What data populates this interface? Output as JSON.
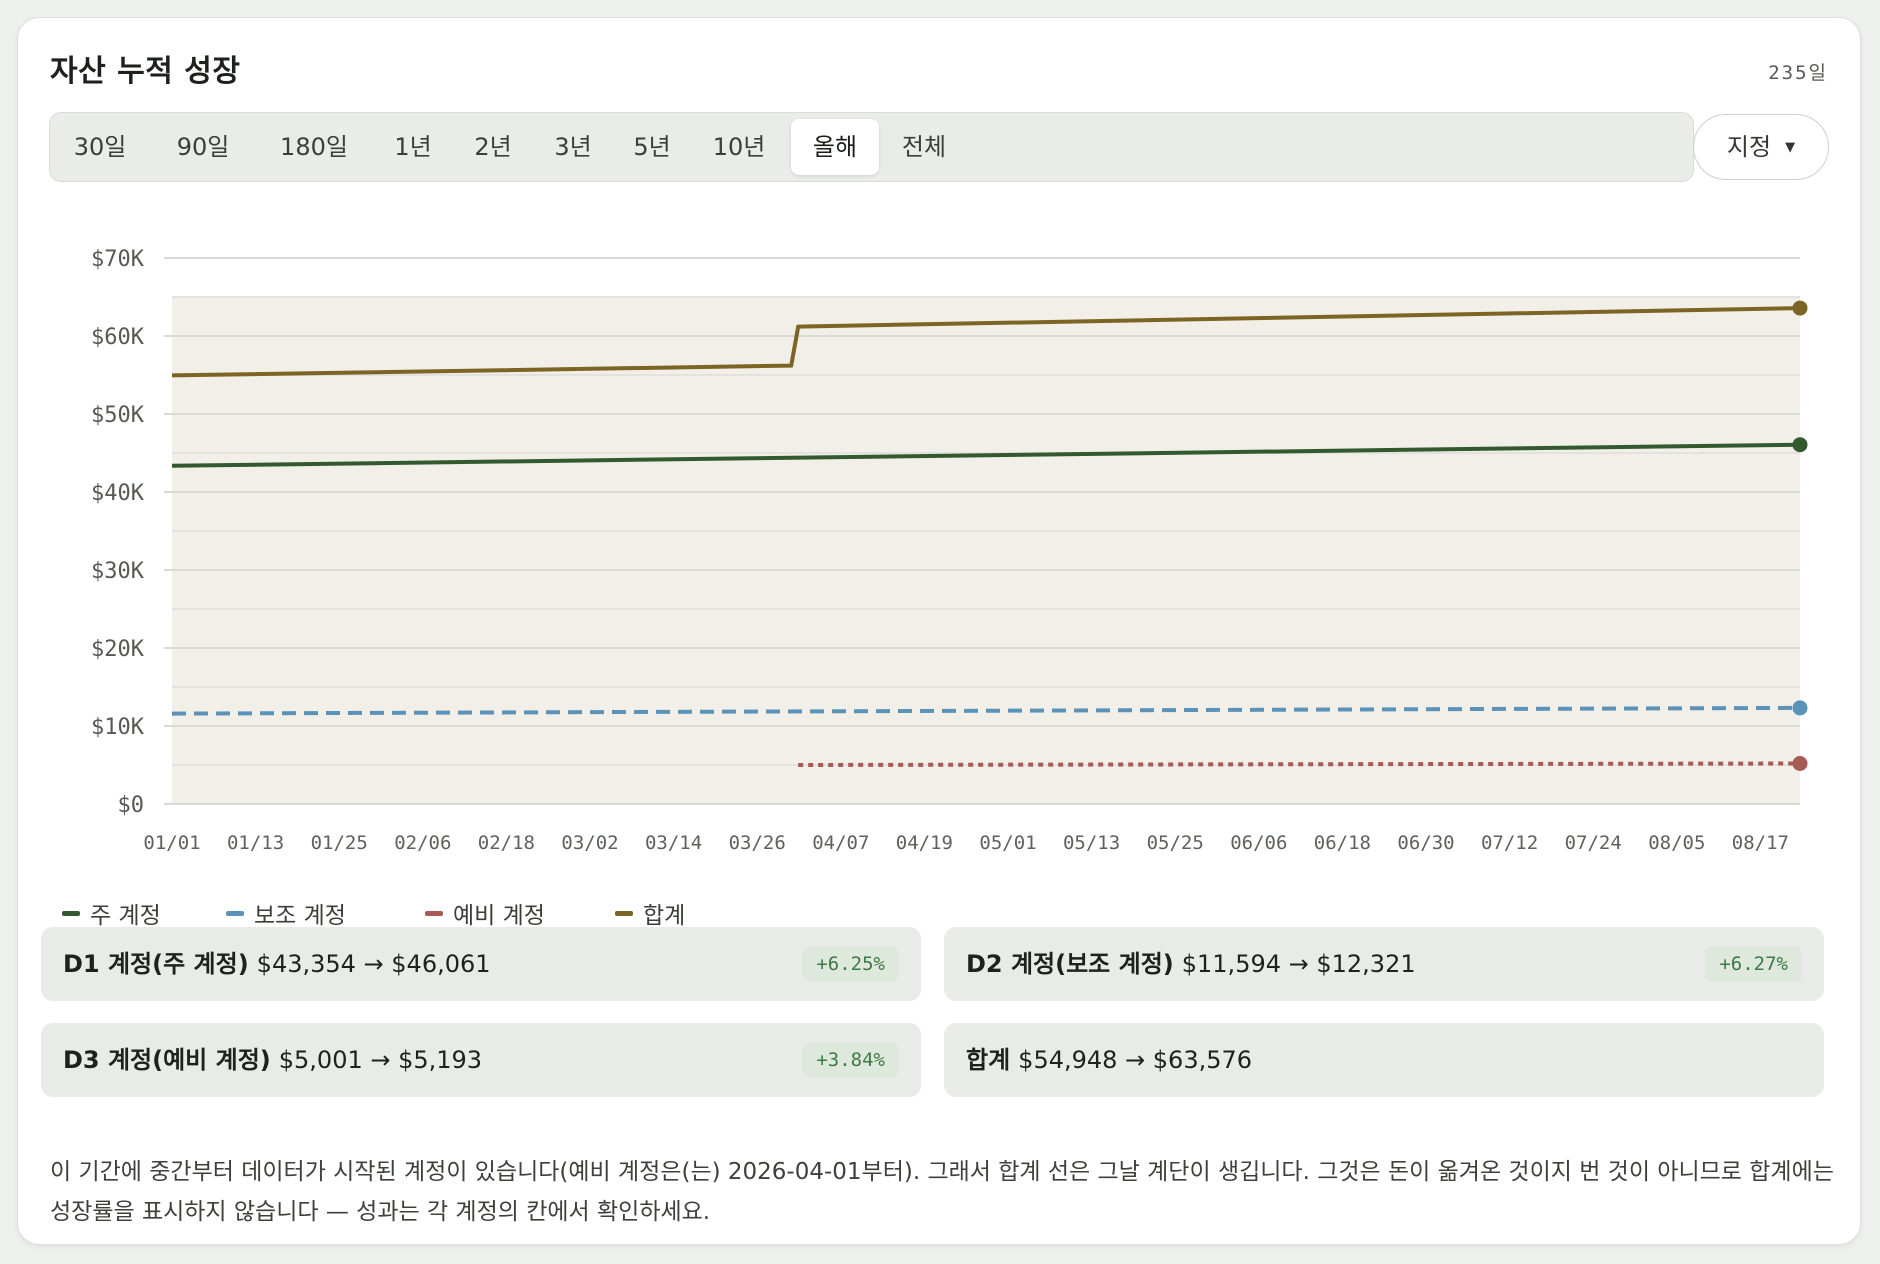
{
  "title": "자산 누적 성장",
  "days_label": "235일",
  "ranges": [
    {
      "label": "30일",
      "active": false
    },
    {
      "label": "90일",
      "active": false
    },
    {
      "label": "180일",
      "active": false
    },
    {
      "label": "1년",
      "active": false
    },
    {
      "label": "2년",
      "active": false
    },
    {
      "label": "3년",
      "active": false
    },
    {
      "label": "5년",
      "active": false
    },
    {
      "label": "10년",
      "active": false
    },
    {
      "label": "올해",
      "active": true
    },
    {
      "label": "전체",
      "active": false
    }
  ],
  "custom_label": "지정",
  "chart_data": {
    "type": "line",
    "ylim": [
      0,
      70000
    ],
    "yticks": [
      "$0",
      "$10K",
      "$20K",
      "$30K",
      "$40K",
      "$50K",
      "$60K",
      "$70K"
    ],
    "yticks_values": [
      0,
      10000,
      20000,
      30000,
      40000,
      50000,
      60000,
      70000
    ],
    "x_ticks": [
      "01/01",
      "01/13",
      "01/25",
      "02/06",
      "02/18",
      "03/02",
      "03/14",
      "03/26",
      "04/07",
      "04/19",
      "05/01",
      "05/13",
      "05/25",
      "06/06",
      "06/18",
      "06/30",
      "07/12",
      "07/24",
      "08/05",
      "08/17"
    ],
    "grid": true,
    "legend_position": "bottom-left",
    "series": [
      {
        "name": "주 계정",
        "color": "#33592f",
        "style": "solid",
        "points": [
          [
            "2026-01-01",
            43354
          ],
          [
            "2026-08-23",
            46061
          ]
        ]
      },
      {
        "name": "보조 계정",
        "color": "#5b93b8",
        "style": "dashed",
        "points": [
          [
            "2026-01-01",
            11594
          ],
          [
            "2026-08-23",
            12321
          ]
        ]
      },
      {
        "name": "예비 계정",
        "color": "#a85a55",
        "style": "dotted",
        "points": [
          [
            "2026-04-01",
            5001
          ],
          [
            "2026-08-23",
            5193
          ]
        ]
      },
      {
        "name": "합계",
        "color": "#7b6424",
        "style": "solid",
        "points": [
          [
            "2026-01-01",
            54948
          ],
          [
            "2026-03-31",
            56202
          ],
          [
            "2026-04-01",
            61210
          ],
          [
            "2026-08-23",
            63576
          ]
        ]
      }
    ]
  },
  "stats": [
    {
      "name": "D1 계정(주 계정)",
      "value": "$43,354 → $46,061",
      "badge": "+6.25%"
    },
    {
      "name": "D2 계정(보조 계정)",
      "value": "$11,594 → $12,321",
      "badge": "+6.27%"
    },
    {
      "name": "D3 계정(예비 계정)",
      "value": "$5,001 → $5,193",
      "badge": "+3.84%"
    },
    {
      "name": "합계",
      "value": "$54,948 → $63,576",
      "badge": ""
    }
  ],
  "note": "이 기간에 중간부터 데이터가 시작된 계정이 있습니다(예비 계정은(는) 2026-04-01부터). 그래서 합계 선은 그날 계단이 생깁니다. 그것은 돈이 옮겨온 것이지 번 것이 아니므로 합계에는 성장률을 표시하지 않습니다 — 성과는 각 계정의 칸에서 확인하세요."
}
